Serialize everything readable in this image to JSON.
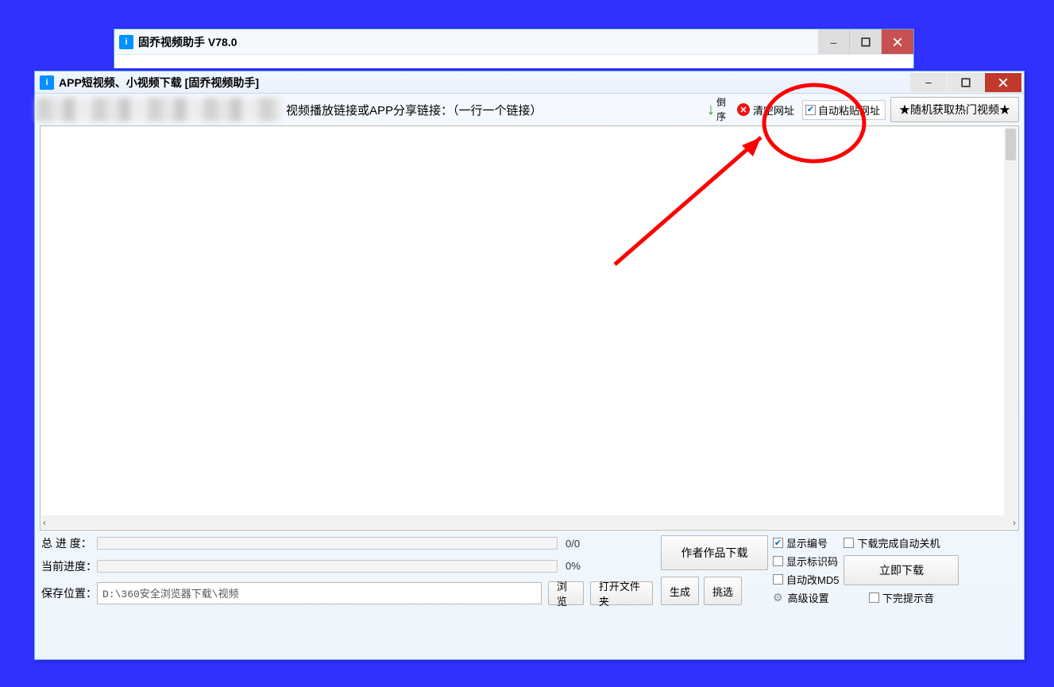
{
  "parentWindow": {
    "title": "固乔视频助手 V78.0"
  },
  "childWindow": {
    "title": "APP短视频、小视频下载 [固乔视频助手]"
  },
  "toolbar": {
    "prompt": "视频播放链接或APP分享链接：（一行一个链接）",
    "reverse_label_1": "倒",
    "reverse_label_2": "序",
    "clear_label": "清空网址",
    "autopaste_label": "自动粘贴网址",
    "hot_label": "★随机获取热门视频★"
  },
  "progress": {
    "total_label": "总 进 度：",
    "current_label": "当前进度：",
    "total_stat": "0/0",
    "current_stat": "0%"
  },
  "save": {
    "label": "保存位置：",
    "path": "D:\\360安全浏览器下载\\视频",
    "browse": "浏览",
    "open_folder": "打开文件夹"
  },
  "buttons": {
    "author": "作者作品下载",
    "generate": "生成",
    "pick": "挑选",
    "download_now": "立即下载"
  },
  "checks": {
    "show_index": "显示编号",
    "show_id": "显示标识码",
    "auto_md5": "自动改MD5",
    "adv_settings": "高级设置",
    "shutdown": "下载完成自动关机",
    "sound": "下完提示音"
  }
}
